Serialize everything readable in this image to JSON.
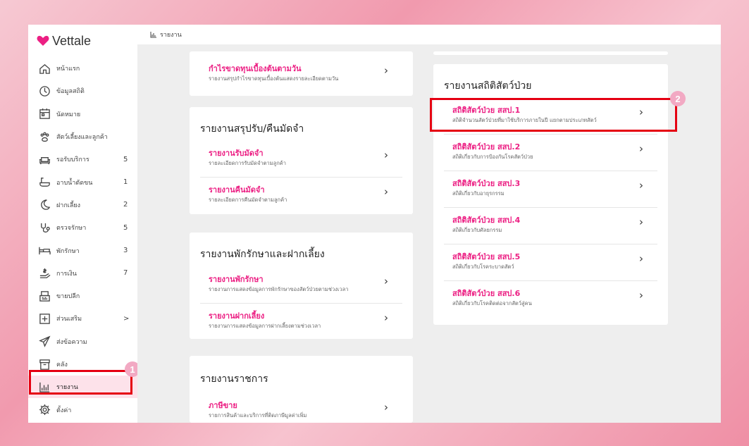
{
  "app": {
    "logo": "Vettale",
    "breadcrumb": "รายงาน"
  },
  "sidebar": {
    "items": [
      {
        "label": "หน้าแรก",
        "count": "",
        "icon": "home-icon"
      },
      {
        "label": "ข้อมูลสถิติ",
        "count": "",
        "icon": "stats-icon"
      },
      {
        "label": "นัดหมาย",
        "count": "",
        "icon": "calendar-icon"
      },
      {
        "label": "สัตว์เลี้ยงและลูกค้า",
        "count": "",
        "icon": "paw-icon"
      },
      {
        "label": "รอรับบริการ",
        "count": "5",
        "icon": "sofa-icon"
      },
      {
        "label": "อาบน้ำตัดขน",
        "count": "1",
        "icon": "bath-icon"
      },
      {
        "label": "ฝากเลี้ยง",
        "count": "2",
        "icon": "moon-icon"
      },
      {
        "label": "ตรวจรักษา",
        "count": "5",
        "icon": "stethoscope-icon"
      },
      {
        "label": "พักรักษา",
        "count": "3",
        "icon": "bed-icon"
      },
      {
        "label": "การเงิน",
        "count": "7",
        "icon": "money-icon"
      },
      {
        "label": "ขายปลีก",
        "count": "",
        "icon": "register-icon"
      },
      {
        "label": "ส่วนเสริม",
        "count": ">",
        "icon": "plus-box-icon"
      },
      {
        "label": "ส่งข้อความ",
        "count": "",
        "icon": "send-icon"
      },
      {
        "label": "คลัง",
        "count": "",
        "icon": "archive-icon"
      },
      {
        "label": "รายงาน",
        "count": "",
        "icon": "chart-icon"
      },
      {
        "label": "ตั้งค่า",
        "count": "",
        "icon": "gear-icon"
      }
    ]
  },
  "badges": {
    "one": "1",
    "two": "2"
  },
  "cards": {
    "profit": {
      "rows": [
        {
          "title": "กำไรขาดทุนเบื้องต้นตามวัน",
          "sub": "รายงานสรุปกำไรขาดทุนเบื้องต้นแสดงรายละเอียดตามวัน"
        }
      ]
    },
    "deposit": {
      "title": "รายงานสรุปรับ/คืนมัดจำ",
      "rows": [
        {
          "title": "รายงานรับมัดจำ",
          "sub": "รายละเอียดการรับมัดจำตามลูกค้า"
        },
        {
          "title": "รายงานคืนมัดจำ",
          "sub": "รายละเอียดการคืนมัดจำตามลูกค้า"
        }
      ]
    },
    "boarding": {
      "title": "รายงานพักรักษาและฝากเลี้ยง",
      "rows": [
        {
          "title": "รายงานพักรักษา",
          "sub": "รายงานการแสดงข้อมูลการพักรักษาของสัตว์ป่วยตามช่วงเวลา"
        },
        {
          "title": "รายงานฝากเลี้ยง",
          "sub": "รายงานการแสดงข้อมูลการฝากเลี้ยงตามช่วงเวลา"
        }
      ]
    },
    "gov": {
      "title": "รายงานราชการ",
      "rows": [
        {
          "title": "ภาษีขาย",
          "sub": "รายการสินค้าและบริการที่ติดภาษีมูลค่าเพิ่ม"
        }
      ]
    },
    "sick": {
      "title": "รายงานสถิติสัตว์ป่วย",
      "rows": [
        {
          "title": "สถิติสัตว์ป่วย สสป.1",
          "sub": "สถิติจำนวนสัตว์ป่วยที่มาใช้บริการภายในปี แยกตามประเภทสัตว์"
        },
        {
          "title": "สถิติสัตว์ป่วย สสป.2",
          "sub": "สถิติเกี่ยวกับการป้องกันโรคสัตว์ป่วย"
        },
        {
          "title": "สถิติสัตว์ป่วย สสป.3",
          "sub": "สถิติเกี่ยวกับอายุรกรรม"
        },
        {
          "title": "สถิติสัตว์ป่วย สสป.4",
          "sub": "สถิติเกี่ยวกับศัลยกรรม"
        },
        {
          "title": "สถิติสัตว์ป่วย สสป.5",
          "sub": "สถิติเกี่ยวกับโรคระบาดสัตว์"
        },
        {
          "title": "สถิติสัตว์ป่วย สสป.6",
          "sub": "สถิติเกี่ยวกับโรคติดต่อจากสัตว์สู่คน"
        }
      ]
    }
  },
  "colors": {
    "accent": "#ec1f83",
    "highlight": "#e50012",
    "badge": "#f2a9c3"
  }
}
